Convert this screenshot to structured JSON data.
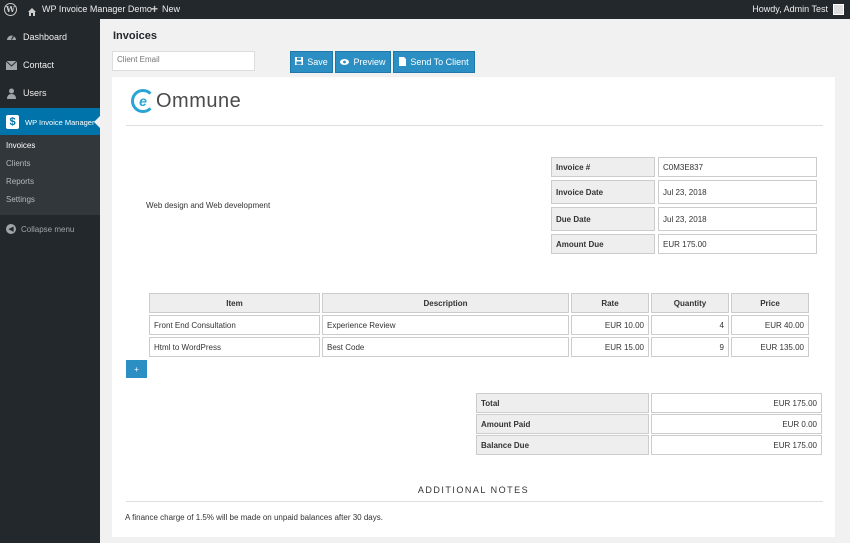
{
  "adminbar": {
    "site_name": "WP Invoice Manager Demo",
    "new_label": "New",
    "howdy": "Howdy, Admin Test"
  },
  "sidebar": {
    "items": [
      {
        "label": "Dashboard",
        "icon": "dashboard-icon"
      },
      {
        "label": "Contact",
        "icon": "mail-icon"
      },
      {
        "label": "Users",
        "icon": "users-icon"
      },
      {
        "label": "WP Invoice Manager",
        "icon": "dollar-icon"
      }
    ],
    "submenu": [
      "Invoices",
      "Clients",
      "Reports",
      "Settings"
    ],
    "collapse_label": "Collapse menu"
  },
  "main": {
    "title": "Invoices",
    "email_placeholder": "Client Email",
    "buttons": {
      "save": "Save",
      "preview": "Preview",
      "send": "Send To Client"
    }
  },
  "invoice": {
    "company": "Ommune",
    "description": "Web design and Web development",
    "meta": [
      {
        "label": "Invoice #",
        "value": "C0M3E837"
      },
      {
        "label": "Invoice Date",
        "value": "Jul 23, 2018"
      },
      {
        "label": "Due Date",
        "value": "Jul 23, 2018"
      },
      {
        "label": "Amount Due",
        "value": "EUR 175.00"
      }
    ],
    "columns": [
      "Item",
      "Description",
      "Rate",
      "Quantity",
      "Price"
    ],
    "rows": [
      [
        "Front End Consultation",
        "Experience Review",
        "EUR 10.00",
        "4",
        "EUR 40.00"
      ],
      [
        "Html to WordPress",
        "Best Code",
        "EUR 15.00",
        "9",
        "EUR 135.00"
      ]
    ],
    "add_row_label": "+",
    "totals": [
      {
        "label": "Total",
        "value": "EUR 175.00"
      },
      {
        "label": "Amount Paid",
        "value": "EUR 0.00"
      },
      {
        "label": "Balance Due",
        "value": "EUR 175.00"
      }
    ],
    "notes_title": "ADDITIONAL NOTES",
    "notes_text": "A finance charge of 1.5% will be made on unpaid balances after 30 days."
  },
  "colors": {
    "accent": "#0073aa",
    "button": "#2c8fc4",
    "sidebar": "#23282d"
  }
}
